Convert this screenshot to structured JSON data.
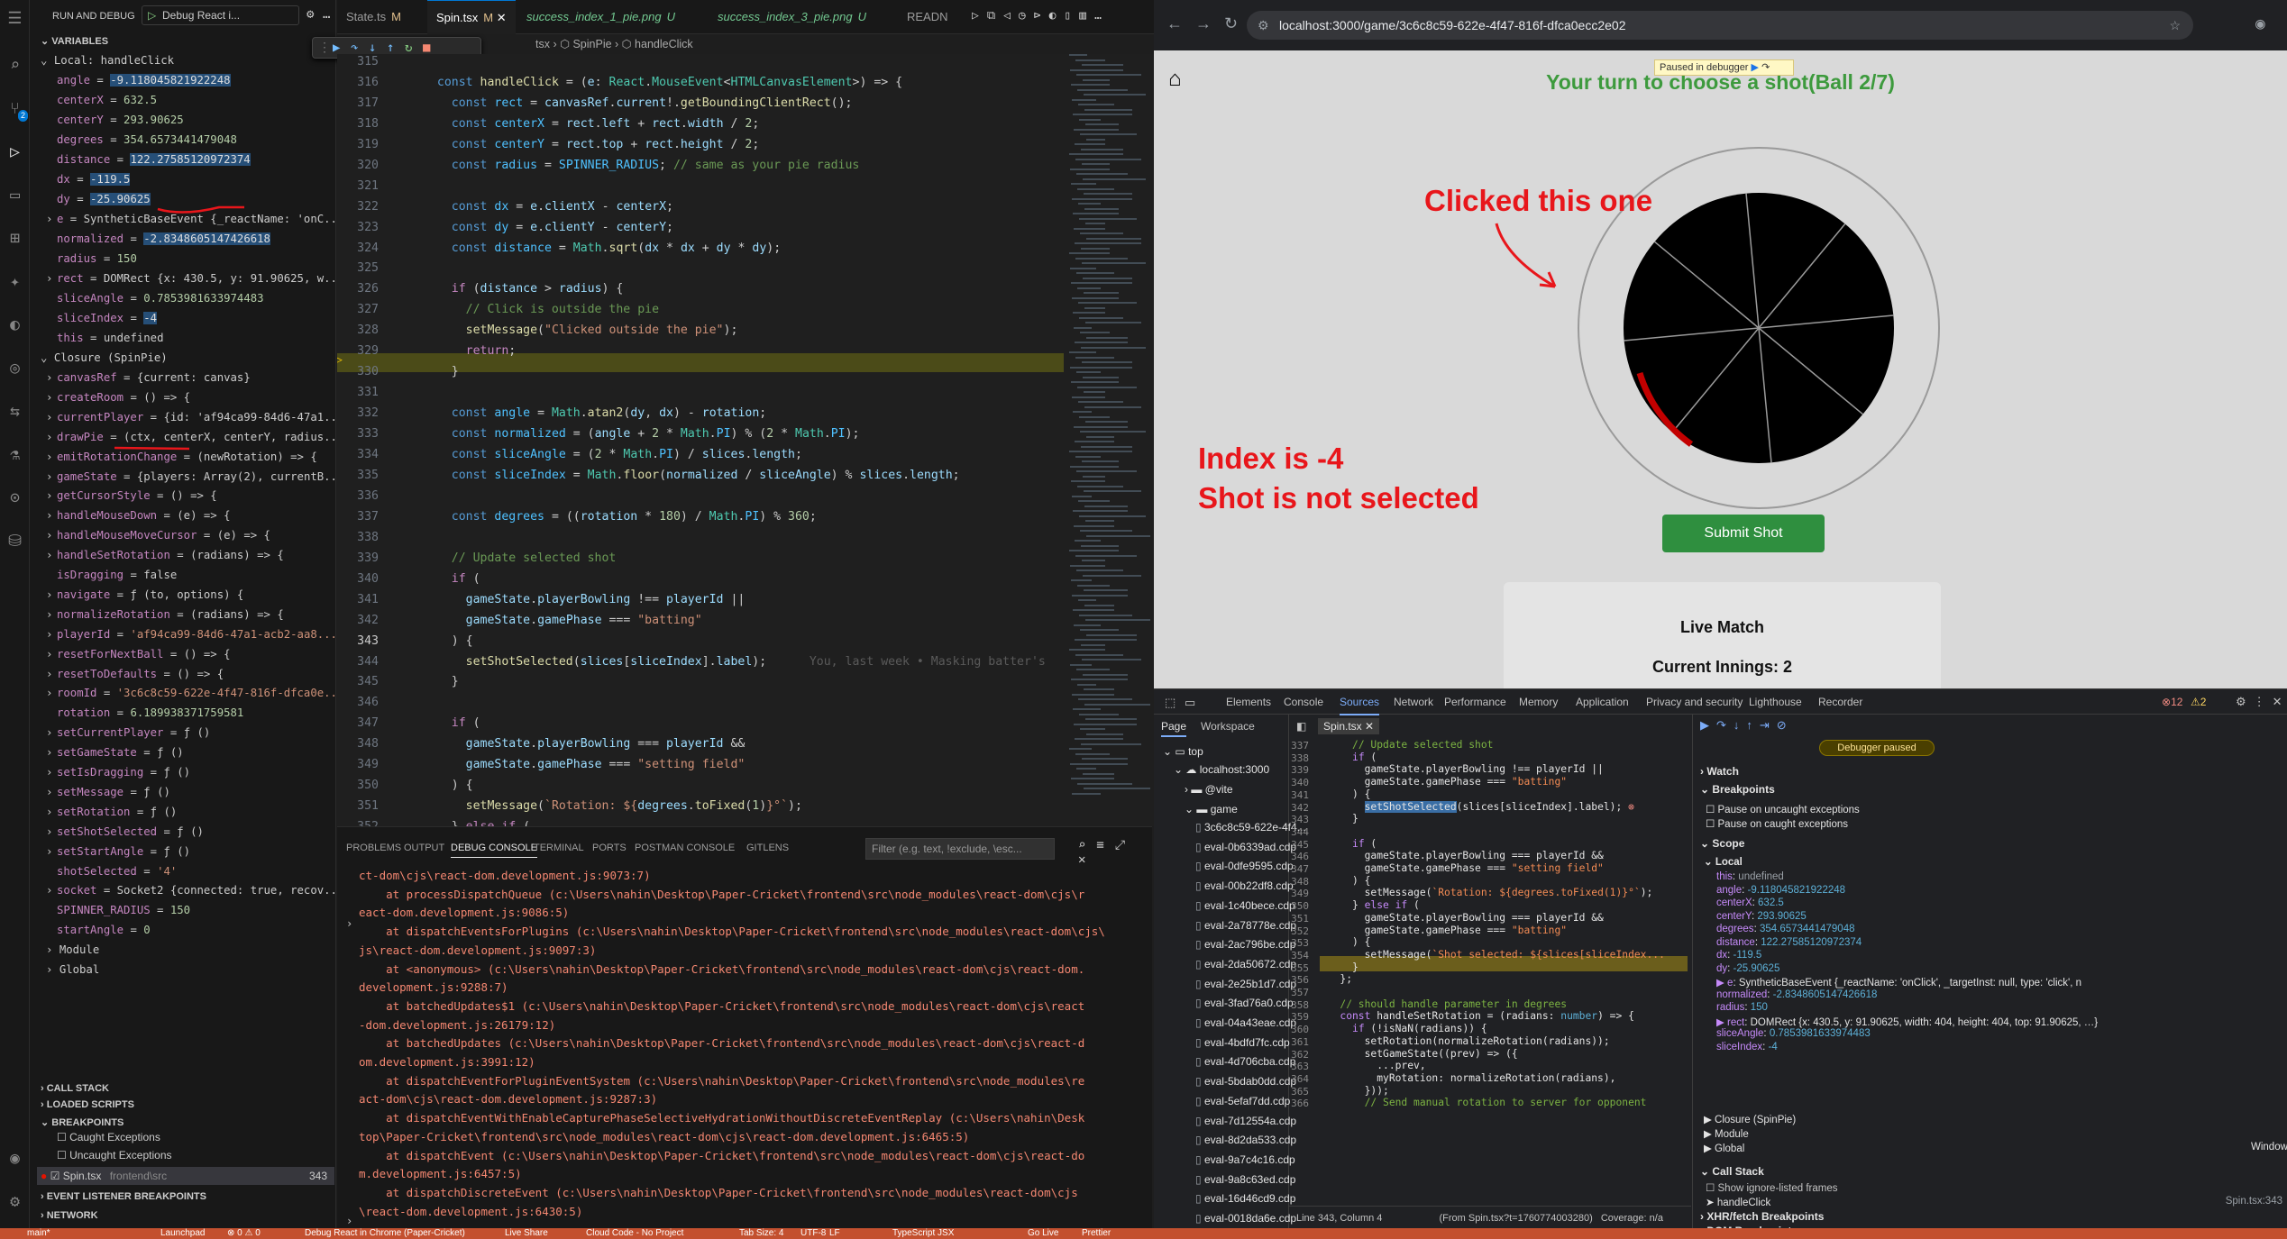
{
  "vscode": {
    "run_and_debug_label": "RUN AND DEBUG",
    "launch_config": "Debug React i...",
    "tabs": [
      {
        "label": "State.ts",
        "mark": "M"
      },
      {
        "label": "Spin.tsx",
        "mark": "M"
      },
      {
        "label": "success_index_1_pie.png",
        "mark": "U"
      },
      {
        "label": "success_index_3_pie.png",
        "mark": "U"
      },
      {
        "label": "READN",
        "mark": ""
      }
    ],
    "breadcrumb": "tsx › ⬡ SpinPie › ⬡ handleClick",
    "variables_header": "VARIABLES",
    "local_header": "Local: handleClick",
    "locals": [
      {
        "name": "angle",
        "value": "-9.118045821922248"
      },
      {
        "name": "centerX",
        "value": "632.5"
      },
      {
        "name": "centerY",
        "value": "293.90625"
      },
      {
        "name": "degrees",
        "value": "354.6573441479048"
      },
      {
        "name": "distance",
        "value": "122.27585120972374"
      },
      {
        "name": "dx",
        "value": "-119.5"
      },
      {
        "name": "dy",
        "value": "-25.90625"
      },
      {
        "name": "e",
        "value": "SyntheticBaseEvent {_reactName: 'onC..."
      },
      {
        "name": "normalized",
        "value": "-2.8348605147426618"
      },
      {
        "name": "radius",
        "value": "150"
      },
      {
        "name": "rect",
        "value": "DOMRect {x: 430.5, y: 91.90625, w..."
      },
      {
        "name": "sliceAngle",
        "value": "0.7853981633974483"
      },
      {
        "name": "sliceIndex",
        "value": "-4"
      },
      {
        "name": "this",
        "value": "undefined"
      }
    ],
    "closure_header": "Closure (SpinPie)",
    "closure": [
      {
        "name": "canvasRef",
        "value": "{current: canvas}"
      },
      {
        "name": "createRoom",
        "value": "() => {"
      },
      {
        "name": "currentPlayer",
        "value": "{id: 'af94ca99-84d6-47a1..."
      },
      {
        "name": "drawPie",
        "value": "(ctx, centerX, centerY, radius..."
      },
      {
        "name": "emitRotationChange",
        "value": "(newRotation) => {"
      },
      {
        "name": "gameState",
        "value": "{players: Array(2), currentB..."
      },
      {
        "name": "getCursorStyle",
        "value": "() => {"
      },
      {
        "name": "handleMouseDown",
        "value": "(e) => {"
      },
      {
        "name": "handleMouseMoveCursor",
        "value": "(e) => {"
      },
      {
        "name": "handleSetRotation",
        "value": "(radians) => {"
      },
      {
        "name": "isDragging",
        "value": "false"
      },
      {
        "name": "navigate",
        "value": "ƒ (to, options) {"
      },
      {
        "name": "normalizeRotation",
        "value": "(radians) => {"
      },
      {
        "name": "playerId",
        "value": "'af94ca99-84d6-47a1-acb2-aa8..."
      },
      {
        "name": "resetForNextBall",
        "value": "() => {"
      },
      {
        "name": "resetToDefaults",
        "value": "() => {"
      },
      {
        "name": "roomId",
        "value": "'3c6c8c59-622e-4f47-816f-dfca0e..."
      },
      {
        "name": "rotation",
        "value": "6.189938371759581"
      },
      {
        "name": "setCurrentPlayer",
        "value": "ƒ ()"
      },
      {
        "name": "setGameState",
        "value": "ƒ ()"
      },
      {
        "name": "setIsDragging",
        "value": "ƒ ()"
      },
      {
        "name": "setMessage",
        "value": "ƒ ()"
      },
      {
        "name": "setRotation",
        "value": "ƒ ()"
      },
      {
        "name": "setShotSelected",
        "value": "ƒ ()"
      },
      {
        "name": "setStartAngle",
        "value": "ƒ ()"
      },
      {
        "name": "shotSelected",
        "value": "'4'"
      },
      {
        "name": "socket",
        "value": "Socket2 {connected: true, recov..."
      },
      {
        "name": "SPINNER_RADIUS",
        "value": "150"
      },
      {
        "name": "startAngle",
        "value": "0"
      }
    ],
    "module_label": "Module",
    "global_label": "Global",
    "call_stack": "CALL STACK",
    "loaded_scripts": "LOADED SCRIPTS",
    "breakpoints": "BREAKPOINTS",
    "caught_exceptions": "Caught Exceptions",
    "uncaught_exceptions": "Uncaught Exceptions",
    "bp_file": "Spin.tsx",
    "bp_path": "frontend\\src",
    "bp_line": "343",
    "event_listener_bp": "EVENT LISTENER BREAKPOINTS",
    "network_label": "NETWORK",
    "code_start_line": 314,
    "inline_hint": "You, last week • Masking batter's",
    "panel_tabs": [
      "PROBLEMS",
      "OUTPUT",
      "DEBUG CONSOLE",
      "TERMINAL",
      "PORTS",
      "POSTMAN CONSOLE",
      "GITLENS"
    ],
    "filter_placeholder": "Filter (e.g. text, !exclude, \\esc...",
    "console_lines": [
      "ct-dom\\cjs\\react-dom.development.js:9073:7)",
      "    at processDispatchQueue (c:\\Users\\nahin\\Desktop\\Paper-Cricket\\frontend\\src\\node_modules\\react-dom\\cjs\\r",
      "eact-dom.development.js:9086:5)",
      "    at dispatchEventsForPlugins (c:\\Users\\nahin\\Desktop\\Paper-Cricket\\frontend\\src\\node_modules\\react-dom\\cjs\\",
      "js\\react-dom.development.js:9097:3)",
      "    at <anonymous> (c:\\Users\\nahin\\Desktop\\Paper-Cricket\\frontend\\src\\node_modules\\react-dom\\cjs\\react-dom.",
      "development.js:9288:7)",
      "    at batchedUpdates$1 (c:\\Users\\nahin\\Desktop\\Paper-Cricket\\frontend\\src\\node_modules\\react-dom\\cjs\\react",
      "-dom.development.js:26179:12)",
      "    at batchedUpdates (c:\\Users\\nahin\\Desktop\\Paper-Cricket\\frontend\\src\\node_modules\\react-dom\\cjs\\react-d",
      "om.development.js:3991:12)",
      "    at dispatchEventForPluginEventSystem (c:\\Users\\nahin\\Desktop\\Paper-Cricket\\frontend\\src\\node_modules\\re",
      "act-dom\\cjs\\react-dom.development.js:9287:3)",
      "    at dispatchEventWithEnableCapturePhaseSelectiveHydrationWithoutDiscreteEventReplay (c:\\Users\\nahin\\Desk",
      "top\\Paper-Cricket\\frontend\\src\\node_modules\\react-dom\\cjs\\react-dom.development.js:6465:5)",
      "    at dispatchEvent (c:\\Users\\nahin\\Desktop\\Paper-Cricket\\frontend\\src\\node_modules\\react-dom\\cjs\\react-do",
      "m.development.js:6457:5)",
      "    at dispatchDiscreteEvent (c:\\Users\\nahin\\Desktop\\Paper-Cricket\\frontend\\src\\node_modules\\react-dom\\cjs",
      "\\react-dom.development.js:6430:5)"
    ],
    "status": [
      "main*",
      "Launchpad",
      "⊗ 0 ⚠ 0",
      "Debug React in Chrome (Paper-Cricket)",
      "Live Share",
      "Cloud Code - No Project",
      "Tab Size: 4",
      "UTF-8",
      "LF",
      "TypeScript JSX",
      "Go Live",
      "Prettier"
    ]
  },
  "browser": {
    "url": "localhost:3000/game/3c6c8c59-622e-4f47-816f-dfca0ecc2e02",
    "paused_label": "Paused in debugger",
    "turn_text": "Your turn to choose a shot(Ball 2/7)",
    "annotation_clicked": "Clicked this one",
    "annotation_index": "Index is -4",
    "annotation_shot": "Shot is not selected",
    "submit_label": "Submit Shot",
    "live_match": "Live Match",
    "innings": "Current Innings: 2",
    "pie_slices": 8,
    "accent_red": "#e8161b"
  },
  "devtools": {
    "tabs": [
      "Elements",
      "Console",
      "Sources",
      "Network",
      "Performance",
      "Memory",
      "Application",
      "Privacy and security",
      "Lighthouse",
      "Recorder"
    ],
    "errors": "12",
    "warnings": "2",
    "nav_tabs": [
      "Page",
      "Workspace"
    ],
    "file_tab": "Spin.tsx",
    "tree_top": "top",
    "tree_host": "localhost:3000",
    "tree_vite": "@vite",
    "tree_game": "game",
    "files": [
      "3c6c8c59-622e-4f4...",
      "eval-0b6339ad.cdp",
      "eval-0dfe9595.cdp",
      "eval-00b22df8.cdp",
      "eval-1c40bece.cdp",
      "eval-2a78778e.cdp",
      "eval-2ac796be.cdp",
      "eval-2da50672.cdp",
      "eval-2e25b1d7.cdp",
      "eval-3fad76a0.cdp",
      "eval-04a43eae.cdp",
      "eval-4bdfd7fc.cdp",
      "eval-4d706cba.cdp",
      "eval-5bdab0dd.cdp",
      "eval-5efaf7dd.cdp",
      "eval-7d12554a.cdp",
      "eval-8d2da533.cdp",
      "eval-9a7c4c16.cdp",
      "eval-9a8c63ed.cdp",
      "eval-16d46cd9.cdp",
      "eval-0018da6e.cdp"
    ],
    "debugger_paused": "Debugger paused",
    "watch": "Watch",
    "breakpoints": "Breakpoints",
    "pause_uncaught": "Pause on uncaught exceptions",
    "pause_caught": "Pause on caught exceptions",
    "scope": "Scope",
    "local": "Local",
    "scope_vars": [
      {
        "k": "this",
        "v": "undefined"
      },
      {
        "k": "angle",
        "v": "-9.118045821922248"
      },
      {
        "k": "centerX",
        "v": "632.5"
      },
      {
        "k": "centerY",
        "v": "293.90625"
      },
      {
        "k": "degrees",
        "v": "354.6573441479048"
      },
      {
        "k": "distance",
        "v": "122.27585120972374"
      },
      {
        "k": "dx",
        "v": "-119.5"
      },
      {
        "k": "dy",
        "v": "-25.90625"
      },
      {
        "k": "▶ e",
        "v": "SyntheticBaseEvent {_reactName: 'onClick', _targetInst: null, type: 'click', n"
      },
      {
        "k": "normalized",
        "v": "-2.8348605147426618"
      },
      {
        "k": "radius",
        "v": "150"
      },
      {
        "k": "▶ rect",
        "v": "DOMRect {x: 430.5, y: 91.90625, width: 404, height: 404, top: 91.90625, …}"
      },
      {
        "k": "sliceAngle",
        "v": "0.7853981633974483"
      },
      {
        "k": "sliceIndex",
        "v": "-4"
      }
    ],
    "closure": "▶ Closure (SpinPie)",
    "module": "▶ Module",
    "global": "▶ Global",
    "window": "Window",
    "call_stack": "Call Stack",
    "show_ignore": "Show ignore-listed frames",
    "frame": "handleClick",
    "frame_loc": "Spin.tsx:343",
    "xhr": "XHR/fetch Breakpoints",
    "dom_bp": "DOM Breakpoints",
    "status_line": "Line 343, Column 4",
    "status_from": "(From Spin.tsx?t=1760774003280)",
    "coverage": "Coverage: n/a",
    "code_start_line": 337
  }
}
